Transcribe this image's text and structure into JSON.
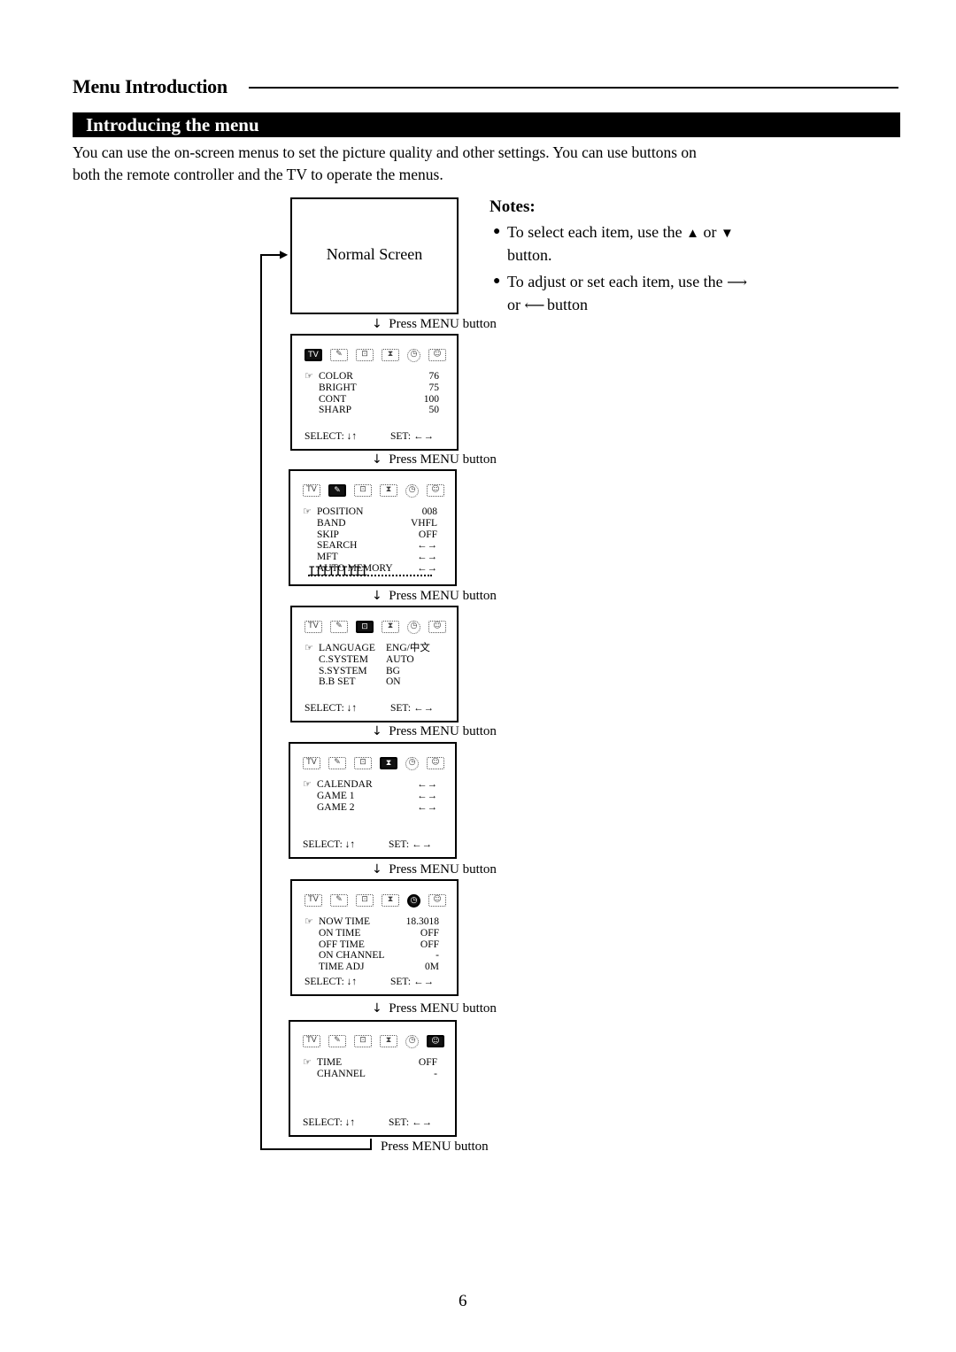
{
  "header": {
    "section_title": "Menu Introduction",
    "subheader": "Introducing the menu"
  },
  "intro": {
    "line1": "You can use the on-screen menus to set the picture quality and other settings. You can use buttons on",
    "line2": "both the remote controller and the TV to operate the menus."
  },
  "notes": {
    "title": "Notes:",
    "items": [
      {
        "text_a": "To select each item, use the",
        "sym1": "▲",
        "mid": "or",
        "sym2": "▼",
        "text_b": "button."
      },
      {
        "text_a": "To adjust or set each item, use the",
        "sym1": "⟶",
        "mid": "or",
        "sym2": "⟵",
        "text_b": "button"
      }
    ]
  },
  "flow": {
    "normal_screen": "Normal Screen",
    "press_label": "Press MENU button",
    "select_label": "SELECT:",
    "select_symbol": "↓↑",
    "set_label": "SET:",
    "set_symbol": "←→",
    "pointer_icon": "☞",
    "icon_tabs": [
      "tv-picture-icon",
      "antenna-tuning-icon",
      "tv-function-icon",
      "game-icon",
      "clock-timer-icon",
      "child-lock-icon"
    ],
    "menus": [
      {
        "name": "picture",
        "active_tab": 0,
        "items": [
          {
            "label": "COLOR",
            "value": "76"
          },
          {
            "label": "BRIGHT",
            "value": "75"
          },
          {
            "label": "CONT",
            "value": "100"
          },
          {
            "label": "SHARP",
            "value": "50"
          }
        ]
      },
      {
        "name": "tuning",
        "active_tab": 1,
        "items": [
          {
            "label": "POSITION",
            "value": "008"
          },
          {
            "label": "BAND",
            "value": "VHFL"
          },
          {
            "label": "SKIP",
            "value": "OFF"
          },
          {
            "label": "SEARCH",
            "value": "←→"
          },
          {
            "label": "MFT",
            "value": "←→"
          },
          {
            "label": "AUTO MEMORY",
            "value": "←→"
          }
        ],
        "progress_bar": "IIIIIIIII"
      },
      {
        "name": "function",
        "active_tab": 2,
        "items": [
          {
            "label": "LANGUAGE",
            "value": "ENG/中文"
          },
          {
            "label": "C.SYSTEM",
            "value": "AUTO"
          },
          {
            "label": "S.SYSTEM",
            "value": "BG"
          },
          {
            "label": "B.B SET",
            "value": "ON"
          }
        ]
      },
      {
        "name": "game",
        "active_tab": 3,
        "items": [
          {
            "label": "CALENDAR",
            "value": "←→"
          },
          {
            "label": "GAME 1",
            "value": "←→"
          },
          {
            "label": "GAME 2",
            "value": "←→"
          }
        ]
      },
      {
        "name": "timer",
        "active_tab": 4,
        "items": [
          {
            "label": "NOW TIME",
            "value": "18.3018"
          },
          {
            "label": "ON   TIME",
            "value": "OFF"
          },
          {
            "label": "OFF  TIME",
            "value": "OFF"
          },
          {
            "label": "ON CHANNEL",
            "value": "-"
          },
          {
            "label": "TIME ADJ",
            "value": "0M"
          }
        ]
      },
      {
        "name": "child-lock",
        "active_tab": 5,
        "items": [
          {
            "label": "TIME",
            "value": "OFF"
          },
          {
            "label": "CHANNEL",
            "value": "-"
          }
        ]
      }
    ]
  },
  "page_number": "6"
}
